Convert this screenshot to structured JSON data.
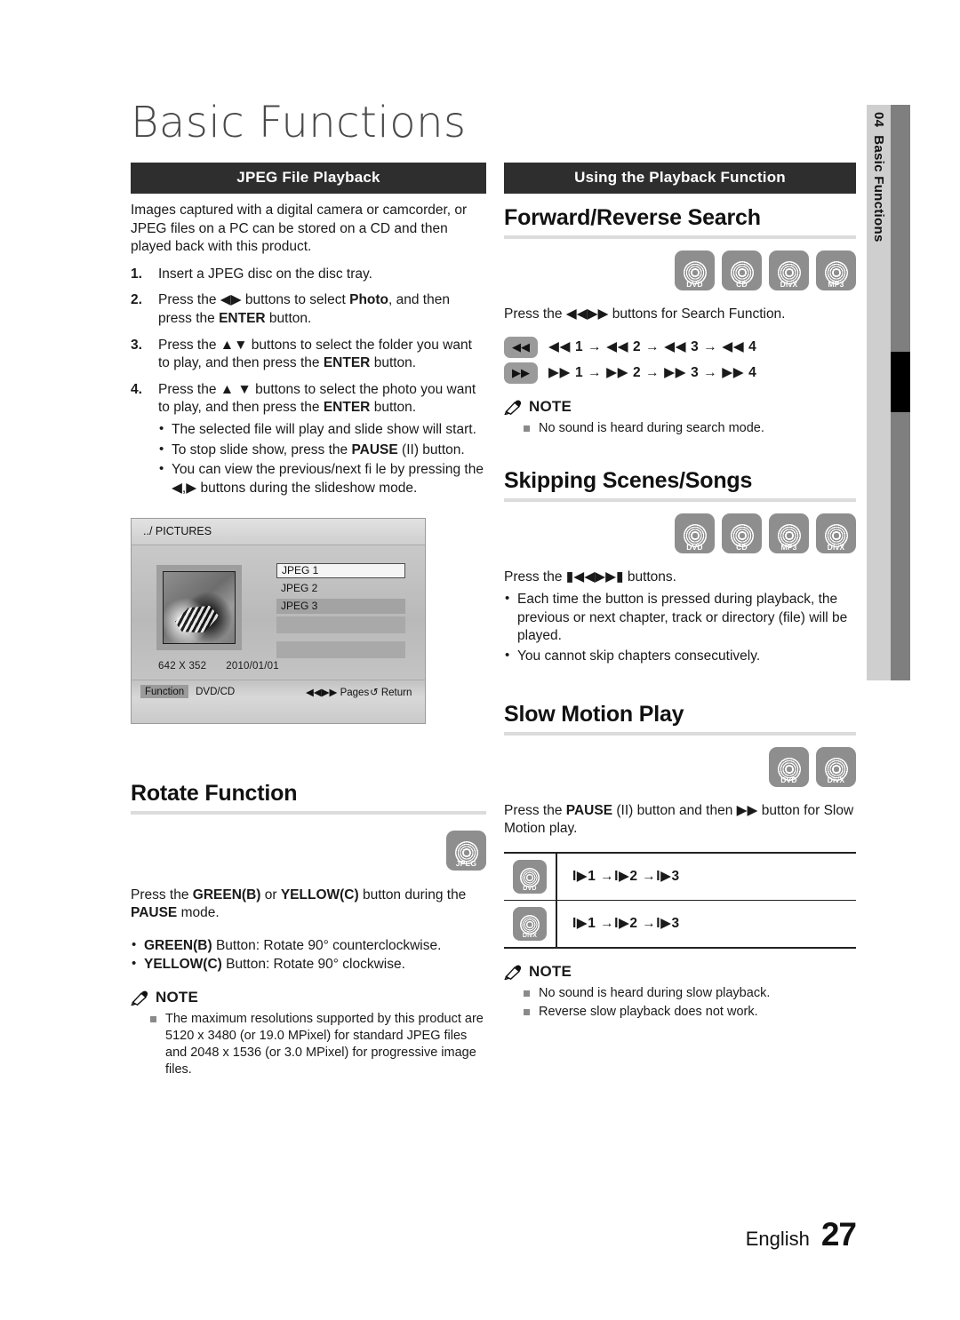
{
  "page": {
    "title": "Basic Functions",
    "side_tab": {
      "number": "04",
      "label": "Basic Functions"
    },
    "footer": {
      "language": "English",
      "page_number": "27"
    }
  },
  "left_column": {
    "section_bar": "JPEG File Playback",
    "intro": "Images captured with a digital camera or camcorder, or JPEG files on a PC can be stored on a CD and then played back with this product.",
    "steps": [
      {
        "num": "1.",
        "text": "Insert a JPEG disc on the disc tray."
      },
      {
        "num": "2.",
        "text": "Press the ◀▶ buttons to select Photo, and then press the ENTER button."
      },
      {
        "num": "3.",
        "text": "Press the ▲▼ buttons to select the folder you want to play, and then press the ENTER button."
      },
      {
        "num": "4.",
        "text": "Press the ▲ ▼ buttons to select the photo you want to play, and then press the ENTER button."
      }
    ],
    "step4_bullets": [
      "The selected file will play and slide show will start.",
      "To stop slide show, press the PAUSE (II) button.",
      "You can view the previous/next fi le by pressing the ◀,▶ buttons during the slideshow mode."
    ],
    "osd": {
      "path": "../ PICTURES",
      "files": [
        "JPEG 1",
        "JPEG 2",
        "JPEG 3"
      ],
      "resolution": "642 X 352",
      "date": "2010/01/01",
      "footer": {
        "function_label": "Function",
        "source": "DVD/CD",
        "pages": "Pages",
        "pages_icon": "◀◀▶▶",
        "return": "Return",
        "return_icon": "↺"
      }
    },
    "rotate": {
      "heading": "Rotate Function",
      "icons": [
        {
          "label": "JPEG"
        }
      ],
      "body": "Press the GREEN(B) or YELLOW(C) button during the PAUSE mode.",
      "bullets": [
        "GREEN(B) Button: Rotate 90° counterclockwise.",
        "YELLOW(C) Button: Rotate 90° clockwise."
      ],
      "note": {
        "label": "NOTE",
        "items": [
          "The maximum resolutions supported by this product are 5120 x 3480 (or 19.0 MPixel) for standard JPEG files and 2048 x 1536 (or 3.0 MPixel) for progressive image files."
        ]
      }
    }
  },
  "right_column": {
    "section_bar": "Using the Playback Function",
    "forward_reverse": {
      "heading": "Forward/Reverse Search",
      "icons": [
        {
          "label": "DVD"
        },
        {
          "label": "CD"
        },
        {
          "label": "DivX"
        },
        {
          "label": "MP3"
        }
      ],
      "body": "Press the ◀◀▶▶ buttons for Search Function.",
      "speed_rows": [
        {
          "key_icon": "◀◀",
          "sequence": "◀◀ 1 → ◀◀ 2 → ◀◀ 3 → ◀◀ 4"
        },
        {
          "key_icon": "▶▶",
          "sequence": "▶▶ 1 → ▶▶ 2 → ▶▶ 3 → ▶▶ 4"
        }
      ],
      "note": {
        "label": "NOTE",
        "items": [
          "No sound is heard during search mode."
        ]
      }
    },
    "skipping": {
      "heading": "Skipping Scenes/Songs",
      "icons": [
        {
          "label": "DVD"
        },
        {
          "label": "CD"
        },
        {
          "label": "MP3"
        },
        {
          "label": "DivX"
        }
      ],
      "body": "Press the ▮◀◀▶▶▮ buttons.",
      "bullets": [
        "Each time the button is pressed during playback, the previous or next chapter, track or directory (file) will be played.",
        "You cannot skip chapters consecutively."
      ]
    },
    "slow_motion": {
      "heading": "Slow Motion Play",
      "icons": [
        {
          "label": "DVD"
        },
        {
          "label": "DivX"
        }
      ],
      "body": "Press the PAUSE (II) button and then ▶▶ button for Slow Motion play.",
      "table_rows": [
        {
          "icon_label": "DVD",
          "sequence": "I▶1 →I▶2 →I▶3"
        },
        {
          "icon_label": "DivX",
          "sequence": "I▶1 →I▶2 →I▶3"
        }
      ],
      "note": {
        "label": "NOTE",
        "items": [
          "No sound is heard during slow playback.",
          "Reverse slow playback does not work."
        ]
      }
    }
  }
}
